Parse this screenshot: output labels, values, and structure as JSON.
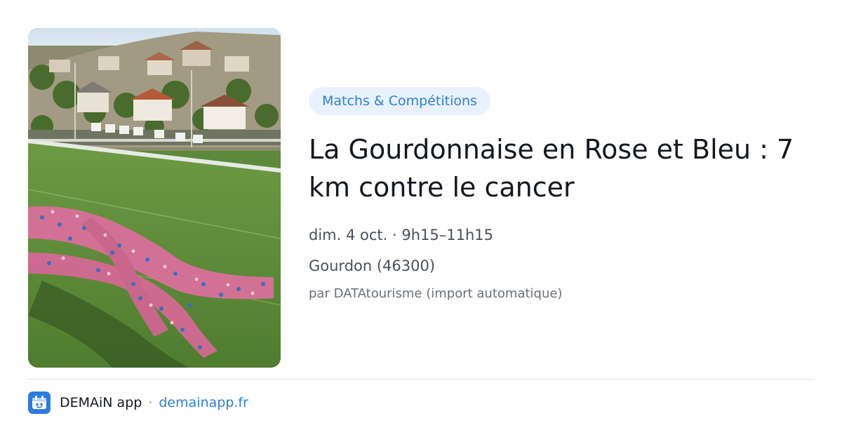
{
  "photo": {
    "alt": "Vue aérienne d'un ruban rose formé par des participants sur un terrain de sport, ville en arrière-plan"
  },
  "event": {
    "category": "Matchs & Compétitions",
    "title": "La Gourdonnaise en Rose et Bleu : 7 km contre le cancer",
    "datetime": "dim. 4 oct. · 9h15–11h15",
    "location": "Gourdon (46300)",
    "source": "par DATAtourisme (import automatique)"
  },
  "footer": {
    "app_name": "DEMAiN app",
    "separator": "·",
    "link": "demainapp.fr"
  },
  "colors": {
    "accent": "#2f7fd6",
    "pill_bg": "#e9f2fc",
    "logo_bg": "#2d7be0",
    "title": "#14181f",
    "meta": "#4a505a"
  },
  "icons": {
    "app_logo": "demain-app-logo-icon"
  }
}
